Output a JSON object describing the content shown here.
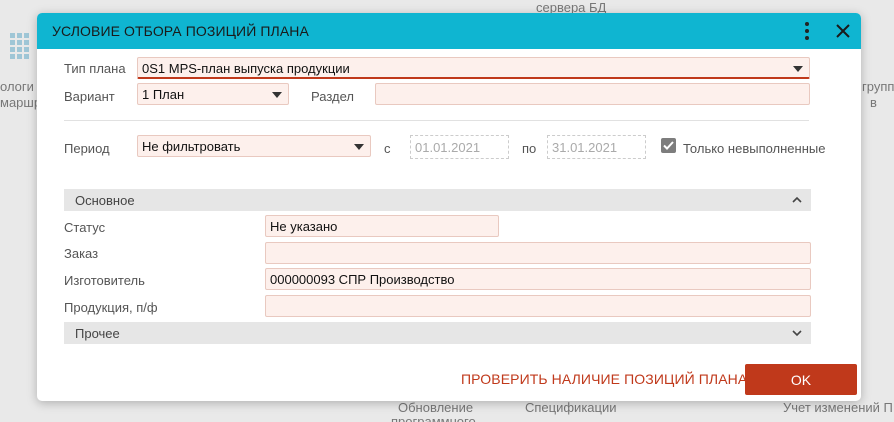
{
  "background": {
    "top_label": "сервера БД",
    "left_label_1": "ологи",
    "left_label_2": "маршр",
    "right_label_1": "группы",
    "right_label_2": "в",
    "bottom_label_1": "Обновление",
    "bottom_label_2": "программного",
    "bottom_label_3": "Спецификации",
    "bottom_label_4": "Учет изменений П"
  },
  "dialog": {
    "title": "УСЛОВИЕ ОТБОРА ПОЗИЦИЙ ПЛАНА",
    "menu_icon": "kebab-menu-icon",
    "close_icon": "close-icon",
    "plan_type": {
      "label": "Тип плана",
      "value": "0S1 MPS-план выпуска продукции"
    },
    "variant": {
      "label": "Вариант",
      "value": "1 План"
    },
    "section_field": {
      "label": "Раздел",
      "value": ""
    },
    "period": {
      "label": "Период",
      "value": "Не фильтровать"
    },
    "date_from": {
      "label": "с",
      "value": "01.01.2021"
    },
    "date_to": {
      "label": "по",
      "value": "31.01.2021"
    },
    "only_unfulfilled": {
      "label": "Только невыполненные",
      "checked": true
    },
    "group_main": {
      "title": "Основное",
      "expanded": true,
      "status": {
        "label": "Статус",
        "value": "Не указано"
      },
      "order": {
        "label": "Заказ",
        "value": ""
      },
      "manufacturer": {
        "label": "Изготовитель",
        "value": "000000093 СПР Производство"
      },
      "product": {
        "label": "Продукция, п/ф",
        "value": ""
      }
    },
    "group_other": {
      "title": "Прочее",
      "expanded": false
    },
    "check_button": "ПРОВЕРИТЬ НАЛИЧИЕ ПОЗИЦИЙ ПЛАНА",
    "ok_button": "OK",
    "colors": {
      "header": "#0fb5d1",
      "accent": "#c0391b",
      "field_bg": "#fdf0ec"
    }
  }
}
